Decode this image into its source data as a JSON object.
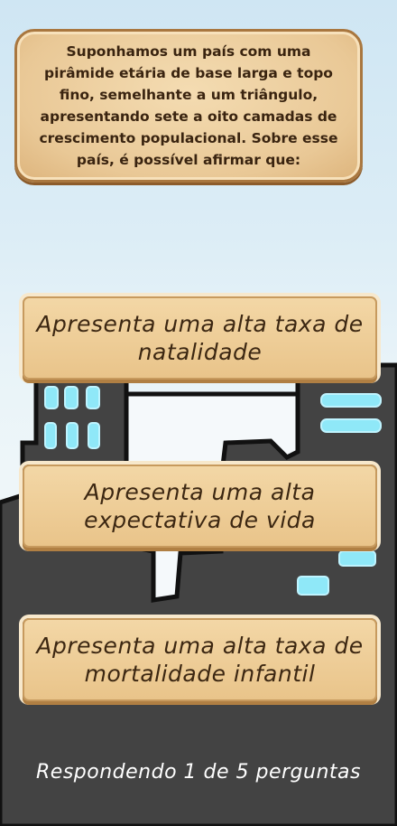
{
  "question": "Suponhamos um país com uma pirâmide etária de base larga e topo fino, semelhante a um triângulo, apresentando sete a oito camadas de crescimento populacional. Sobre esse país, é possível afirmar que:",
  "answers": [
    {
      "label": "Apresenta uma alta taxa de natalidade"
    },
    {
      "label": "Apresenta uma alta expectativa de vida"
    },
    {
      "label": "Apresenta uma alta taxa de mortalidade infantil"
    }
  ],
  "progress": {
    "text": "Respondendo 1 de 5 perguntas",
    "current": 1,
    "total": 5
  },
  "colors": {
    "board": "#e9c896",
    "answer": "#efcf9a",
    "ground": "#444444",
    "glow": "#8fe8f8",
    "sky": "#d6ebf5"
  }
}
